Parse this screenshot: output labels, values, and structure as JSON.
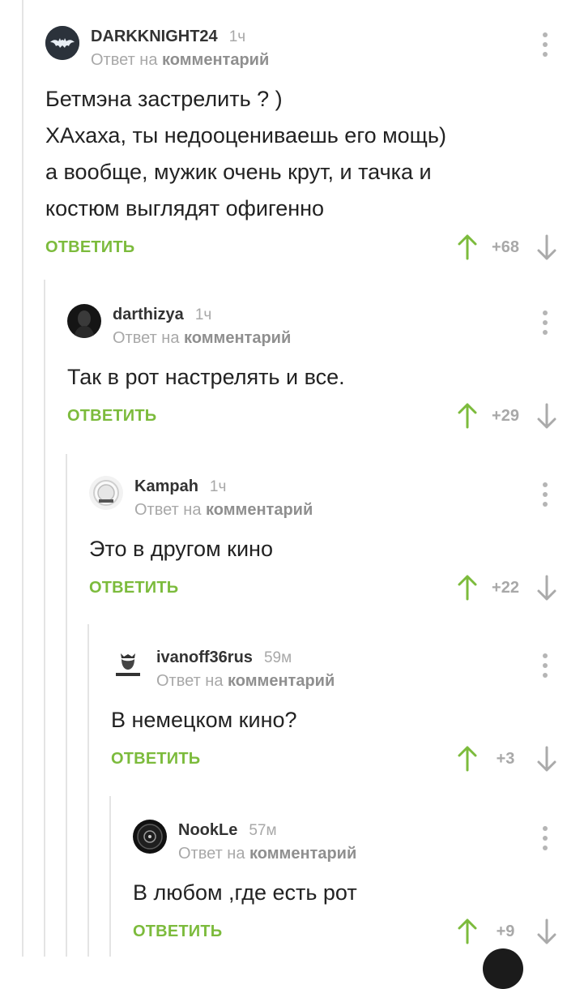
{
  "thread": {
    "reply_prefix": "Ответ на",
    "reply_target": "комментарий",
    "reply_label": "ОТВЕТИТЬ"
  },
  "comments": [
    {
      "author": "DARKKNIGHT24",
      "time": "1ч",
      "text": "Бетмэна застрелить ? )\nХАхаха, ты недооцениваешь его мощь)\nа вообще, мужик очень крут, и тачка и\nкостюм выглядят офигенно",
      "rating": "+68"
    },
    {
      "author": "darthizya",
      "time": "1ч",
      "text": "Так в рот настрелять и все.",
      "rating": "+29"
    },
    {
      "author": "Kampah",
      "time": "1ч",
      "text": "Это в другом кино",
      "rating": "+22"
    },
    {
      "author": "ivanoff36rus",
      "time": "59м",
      "text": "В немецком кино?",
      "rating": "+3"
    },
    {
      "author": "NookLe",
      "time": "57м",
      "text": "В любом ,где есть рот",
      "rating": "+9"
    }
  ],
  "colors": {
    "accent_green": "#7cbb3c",
    "muted_gray": "#a8a8a8",
    "thread_line": "#e4e4e4"
  },
  "icons": {
    "menu": "more-vertical-icon",
    "upvote": "arrow-up-icon",
    "downvote": "arrow-down-icon"
  }
}
